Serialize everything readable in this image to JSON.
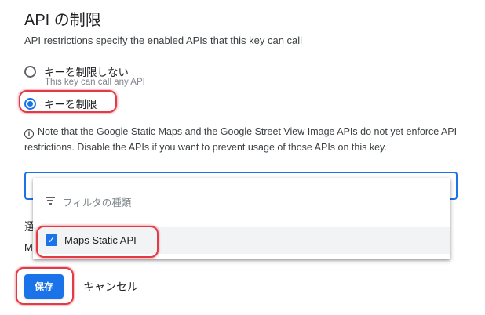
{
  "section": {
    "title": "API の制限",
    "description": "API restrictions specify the enabled APIs that this key can call"
  },
  "options": {
    "unrestricted_label": "キーを制限しない",
    "unrestricted_helper": "This key can call any API",
    "restricted_label": "キーを制限",
    "selected": "restricted"
  },
  "note": "Note that the Google Static Maps and the Google Street View Image APIs do not yet enforce API restrictions. Disable the APIs if you want to prevent usage of those APIs on this key.",
  "dropdown": {
    "filter_placeholder": "フィルタの種類",
    "items": [
      {
        "label": "Maps Static API",
        "checked": true
      }
    ]
  },
  "partially_hidden": {
    "label_fragment": "選",
    "value_fragment": "M"
  },
  "actions": {
    "save_label": "保存",
    "cancel_label": "キャンセル"
  },
  "colors": {
    "accent": "#1a73e8",
    "highlight": "#e23b47"
  },
  "icons": [
    "radio-icon",
    "info-icon",
    "filter-icon",
    "checkbox-icon"
  ]
}
